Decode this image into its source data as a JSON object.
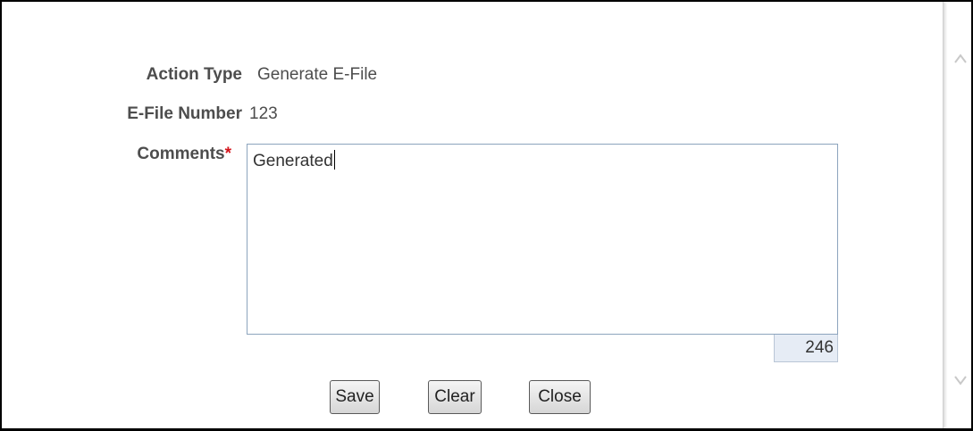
{
  "form": {
    "action_type_label": "Action Type",
    "action_type_value": "Generate E-File",
    "efile_number_label": "E-File Number",
    "efile_number_value": "123",
    "comments_label": "Comments",
    "required_marker": "*",
    "comments_value": "Generated",
    "char_counter": "246"
  },
  "buttons": {
    "save_label": "Save",
    "clear_label": "Clear",
    "close_label": "Close"
  },
  "icons": {
    "scroll_up": "chevron-up-icon",
    "scroll_down": "chevron-down-icon"
  },
  "colors": {
    "required": "#d4141b",
    "field_border": "#8ca4bd",
    "counter_bg": "#e6ecf5"
  }
}
